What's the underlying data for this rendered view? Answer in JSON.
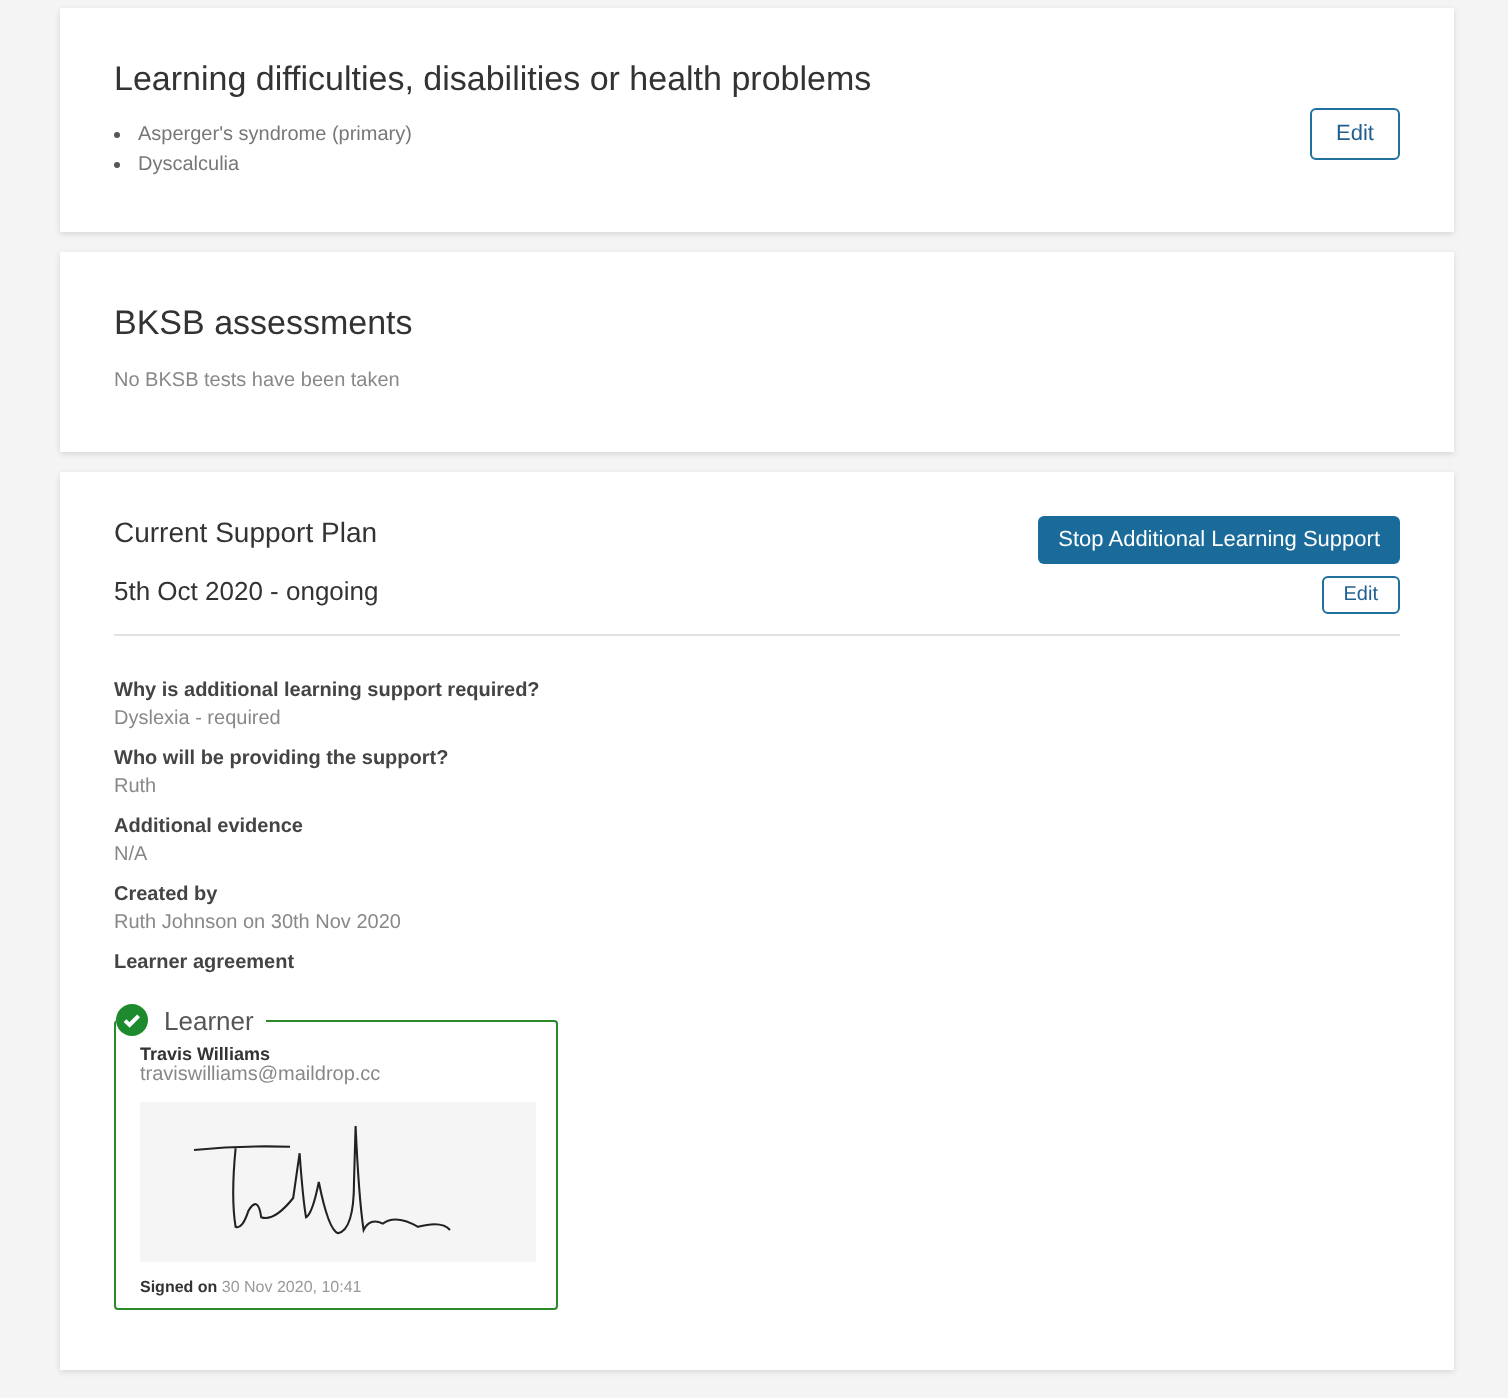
{
  "conditions_card": {
    "title": "Learning difficulties, disabilities or health problems",
    "items": [
      "Asperger's syndrome (primary)",
      "Dyscalculia"
    ],
    "edit_button": "Edit"
  },
  "bksb_card": {
    "title": "BKSB assessments",
    "message": "No BKSB tests have been taken"
  },
  "support_plan": {
    "title": "Current Support Plan",
    "period": "5th Oct 2020 - ongoing",
    "stop_button": "Stop Additional Learning Support",
    "edit_button": "Edit",
    "fields": [
      {
        "label": "Why is additional learning support required?",
        "value": "Dyslexia - required"
      },
      {
        "label": "Who will be providing the support?",
        "value": "Ruth"
      },
      {
        "label": "Additional evidence",
        "value": "N/A"
      },
      {
        "label": "Created by",
        "value": "Ruth Johnson on 30th Nov 2020"
      }
    ],
    "agreement_label": "Learner agreement",
    "agreement": {
      "role": "Learner",
      "signed": true,
      "name": "Travis Williams",
      "email": "traviswilliams@maildrop.cc",
      "signed_on": "**Signed on** 30 Nov 2020, 10:41"
    }
  }
}
